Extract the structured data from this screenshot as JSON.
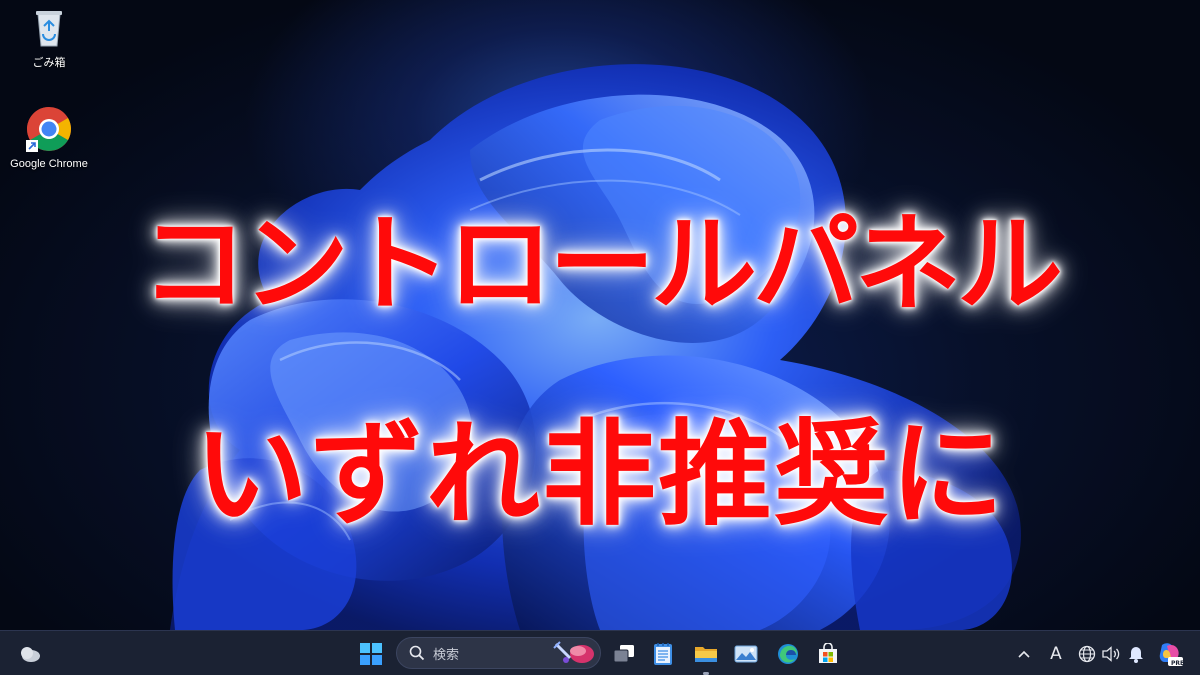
{
  "desktop": {
    "icons": [
      {
        "label": "ごみ箱",
        "icon": "recycle-bin-icon"
      },
      {
        "label": "Google Chrome",
        "icon": "chrome-icon"
      }
    ]
  },
  "headline": {
    "line1": "コントロールパネル",
    "line2": "いずれ非推奨に",
    "color": "#ff0a0a",
    "glow_color": "#ffffff"
  },
  "taskbar": {
    "search_placeholder": "検索",
    "left_widget": "weather-icon",
    "apps": [
      "start-icon",
      "search-icon",
      "task-view-icon",
      "notepad-icon",
      "file-explorer-icon",
      "photos-icon",
      "edge-icon",
      "store-icon"
    ],
    "tray": {
      "ime_indicator": "A",
      "icons": [
        "chevron-up-icon",
        "network-icon",
        "volume-icon",
        "bell-icon",
        "copilot-icon"
      ],
      "copilot_badge": "PRE"
    }
  },
  "colors": {
    "taskbar_bg": "#1b2233",
    "accent_blue": "#3a6bff"
  }
}
